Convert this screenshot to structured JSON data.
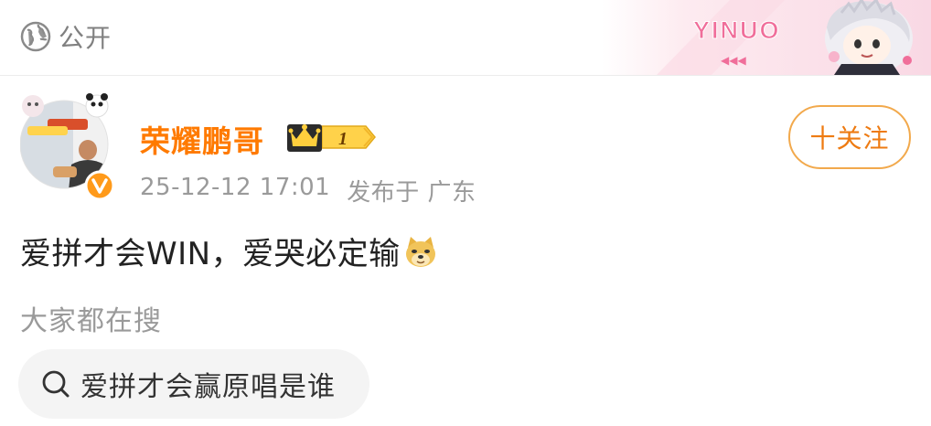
{
  "header": {
    "visibility_label": "公开",
    "visibility_icon": "globe-icon",
    "banner_text": "YINUO",
    "banner_sub": "◀◀◀"
  },
  "post": {
    "author": "荣耀鹏哥",
    "vip_level": "1",
    "timestamp": "25-12-12 17:01",
    "location": "发布于 广东",
    "follow_label": "十关注",
    "text": "爱拼才会WIN，爱哭必定输",
    "emoji": "doge-icon"
  },
  "hot_search": {
    "label": "大家都在搜",
    "query": "爱拼才会赢原唱是谁"
  },
  "colors": {
    "accent": "#ff7a00",
    "follow_border": "#f2a94c",
    "muted": "#9a9a9a",
    "chip_bg": "#f4f4f4"
  }
}
